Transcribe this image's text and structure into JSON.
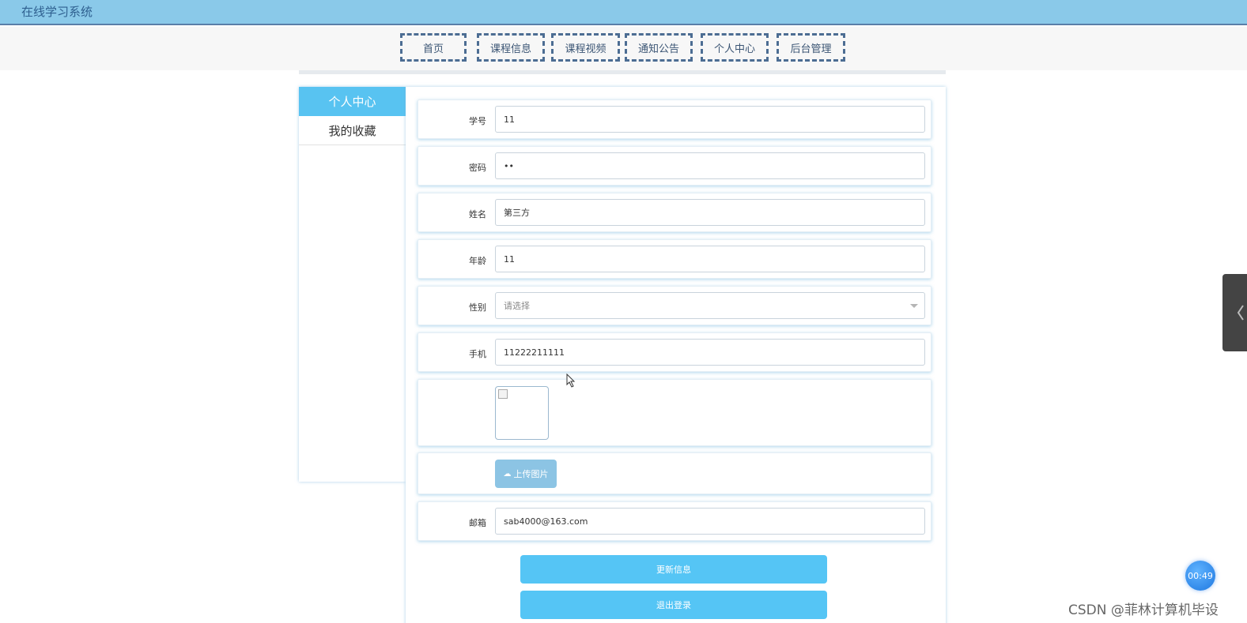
{
  "header": {
    "site_title": "在线学习系统"
  },
  "nav": [
    {
      "label": "首页"
    },
    {
      "label": "课程信息"
    },
    {
      "label": "课程视频"
    },
    {
      "label": "通知公告"
    },
    {
      "label": "个人中心"
    },
    {
      "label": "后台管理"
    }
  ],
  "sidebar": {
    "items": [
      {
        "label": "个人中心",
        "active": true
      },
      {
        "label": "我的收藏",
        "active": false
      }
    ]
  },
  "form": {
    "student_id": {
      "label": "学号",
      "value": "11"
    },
    "password": {
      "label": "密码",
      "value": "••"
    },
    "name": {
      "label": "姓名",
      "value": "第三方"
    },
    "age": {
      "label": "年龄",
      "value": "11"
    },
    "gender": {
      "label": "性别",
      "placeholder": "请选择"
    },
    "phone": {
      "label": "手机",
      "value": "11222211111"
    },
    "upload_label": "上传图片",
    "email": {
      "label": "邮箱",
      "value": "sab4000@163.com"
    },
    "update_button": "更新信息",
    "logout_button": "退出登录"
  },
  "timer": "00:49",
  "watermark": "CSDN @菲林计算机毕设",
  "colors": {
    "topbar": "#8ac9e9",
    "accent": "#55c5f5",
    "nav_border": "#4c6d93",
    "upload_button": "#8cc4e4"
  }
}
